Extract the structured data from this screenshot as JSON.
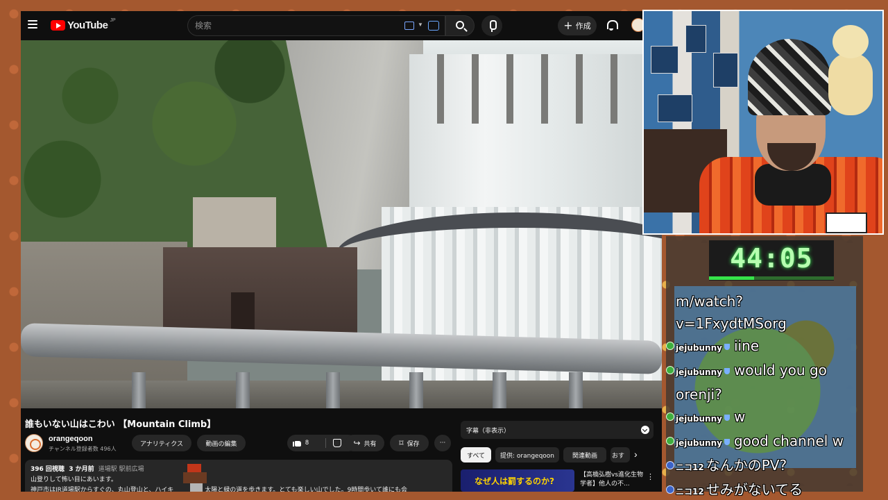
{
  "youtube": {
    "logo_text": "YouTube",
    "logo_region": "JP",
    "search_placeholder": "検索",
    "create_label": "作成",
    "video_title": "誰もいない山はこわい 【Mountain Climb】",
    "channel": {
      "name": "orangeqoon",
      "subscribers": "チャンネル登録者数 496人"
    },
    "buttons": {
      "analytics": "アナリティクス",
      "edit_video": "動画の編集",
      "like_count": "8",
      "share": "共有",
      "save": "保存"
    },
    "description": {
      "views": "396 回視聴",
      "ago": "3 か月前",
      "tags": "道場駅 駅前広場",
      "line1": "山登りして怖い目にあいます。",
      "line2": "神戸市はJR道場駅からすぐの、丸山登山と、ハイキ　　　　　太陽と緑の道を歩きます。とても楽しい山でした。9時間歩いて誰にも会"
    },
    "captions_label": "字幕（非表示）",
    "chips": [
      "すべて",
      "提供: orangeqoon",
      "関連動画",
      "おす"
    ],
    "recommendation": {
      "thumb_text": "なぜ人は罰するのか?",
      "title": "【高橋弘樹vs進化生物学者】他人の不..."
    }
  },
  "timer": {
    "display": "44:05",
    "progress": 0.36
  },
  "chat": {
    "messages": [
      {
        "user": "",
        "text": "m/watch?",
        "dot": ""
      },
      {
        "user": "",
        "text": "v=1FxydtMSorg",
        "dot": ""
      },
      {
        "user": "jejubunny",
        "text": "iine",
        "dot": "green"
      },
      {
        "user": "jejubunny",
        "text": "would you go",
        "dot": "green"
      },
      {
        "user": "",
        "text": "orenji?",
        "dot": ""
      },
      {
        "user": "jejubunny",
        "text": "w",
        "dot": "green"
      },
      {
        "user": "jejubunny",
        "text": "good channel w",
        "dot": "green"
      },
      {
        "user": "ニコ12",
        "text": "なんかのPV?",
        "dot": "blue"
      },
      {
        "user": "ニコ12",
        "text": "せみがないてる",
        "dot": "blue"
      }
    ]
  },
  "colors": {
    "youtube_red": "#ff0000",
    "timer_green": "#36e34a",
    "page_bg": "#0f0f0f"
  }
}
